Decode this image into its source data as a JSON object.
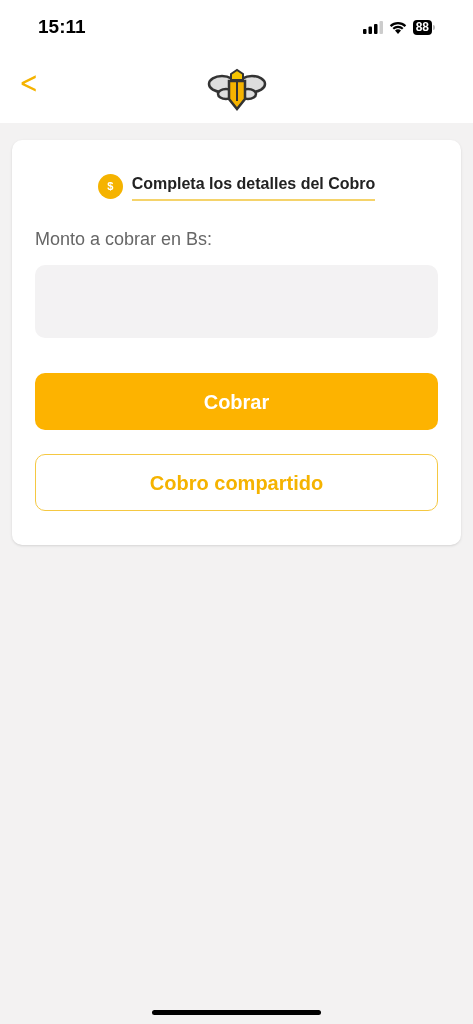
{
  "status_bar": {
    "time": "15:11",
    "battery": "88"
  },
  "header": {
    "back": "<"
  },
  "card": {
    "coin": "$",
    "title": "Completa los detalles del Cobro",
    "field_label": "Monto a cobrar en Bs:",
    "buttons": [
      {
        "label": "Cobrar",
        "kind": "primary"
      },
      {
        "label": "Cobro compartido",
        "kind": "outline"
      }
    ]
  }
}
